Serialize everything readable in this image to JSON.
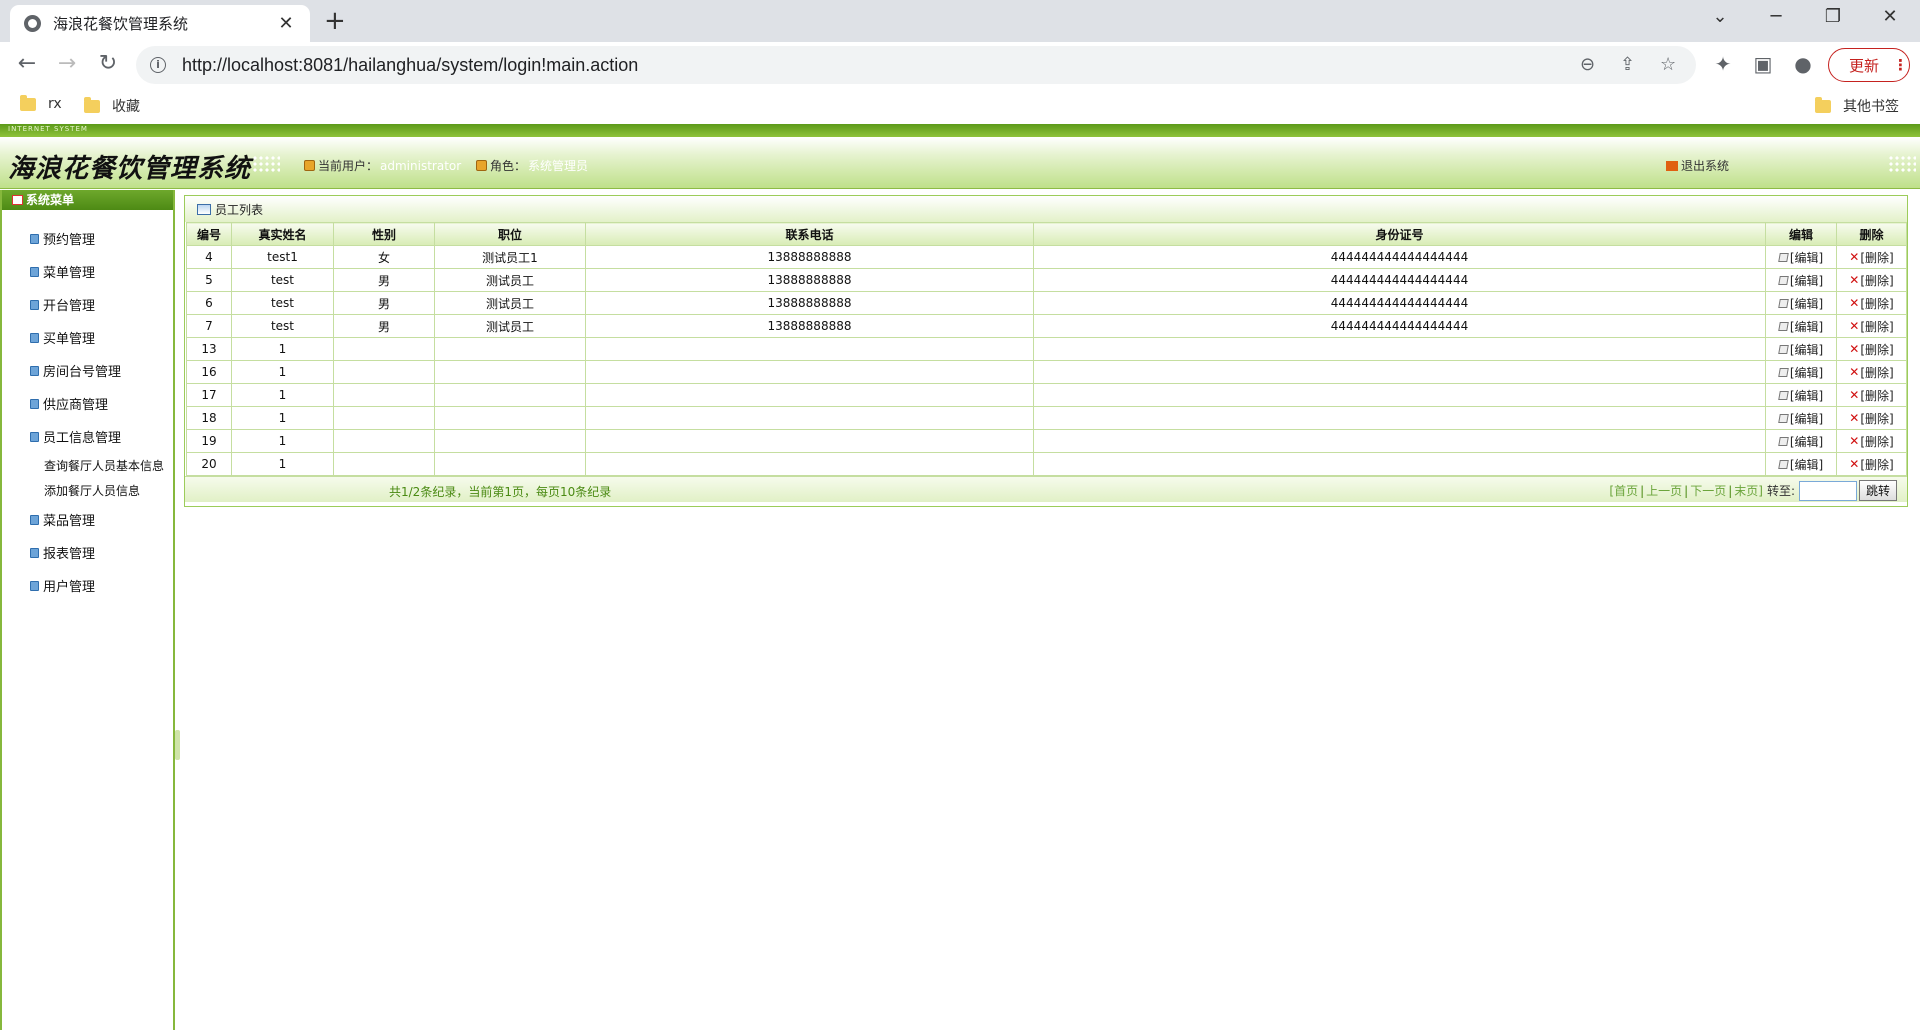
{
  "browser": {
    "tab_title": "海浪花餐饮管理系统",
    "url": "http://localhost:8081/hailanghua/system/login!main.action",
    "update_label": "更新",
    "bookmarks": [
      "rx",
      "收藏"
    ],
    "other_bookmarks": "其他书签"
  },
  "app": {
    "topbar_text": "INTERNET SYSTEM",
    "logo": "海浪花餐饮管理系统",
    "current_user_label": "当前用户：",
    "current_user": "administrator",
    "role_label": "角色：",
    "role": "系统管理员",
    "logout": "退出系统"
  },
  "sidebar": {
    "title": "系统菜单",
    "items": [
      {
        "label": "预约管理"
      },
      {
        "label": "菜单管理"
      },
      {
        "label": "开台管理"
      },
      {
        "label": "买单管理"
      },
      {
        "label": "房间台号管理"
      },
      {
        "label": "供应商管理"
      },
      {
        "label": "员工信息管理"
      }
    ],
    "subitems": [
      "查询餐厅人员基本信息",
      "添加餐厅人员信息"
    ],
    "items_after": [
      {
        "label": "菜品管理"
      },
      {
        "label": "报表管理"
      },
      {
        "label": "用户管理"
      }
    ]
  },
  "panel": {
    "title": "员工列表",
    "columns": [
      "编号",
      "真实姓名",
      "性别",
      "职位",
      "联系电话",
      "身份证号",
      "编辑",
      "删除"
    ],
    "edit_label": "[编辑]",
    "delete_label": "[删除]",
    "rows": [
      [
        "4",
        "test1",
        "女",
        "测试员工1",
        "13888888888",
        "444444444444444444"
      ],
      [
        "5",
        "test",
        "男",
        "测试员工",
        "13888888888",
        "444444444444444444"
      ],
      [
        "6",
        "test",
        "男",
        "测试员工",
        "13888888888",
        "444444444444444444"
      ],
      [
        "7",
        "test",
        "男",
        "测试员工",
        "13888888888",
        "444444444444444444"
      ],
      [
        "13",
        "1",
        "",
        "",
        "",
        ""
      ],
      [
        "16",
        "1",
        "",
        "",
        "",
        ""
      ],
      [
        "17",
        "1",
        "",
        "",
        "",
        ""
      ],
      [
        "18",
        "1",
        "",
        "",
        "",
        ""
      ],
      [
        "19",
        "1",
        "",
        "",
        "",
        ""
      ],
      [
        "20",
        "1",
        "",
        "",
        "",
        ""
      ]
    ],
    "pager": {
      "summary": "共1/2条纪录，当前第1页，每页10条纪录",
      "first": "[首页",
      "prev": "上一页",
      "next": "下一页",
      "last": "末页]",
      "goto_label": "转至:",
      "goto_button": "跳转"
    }
  }
}
